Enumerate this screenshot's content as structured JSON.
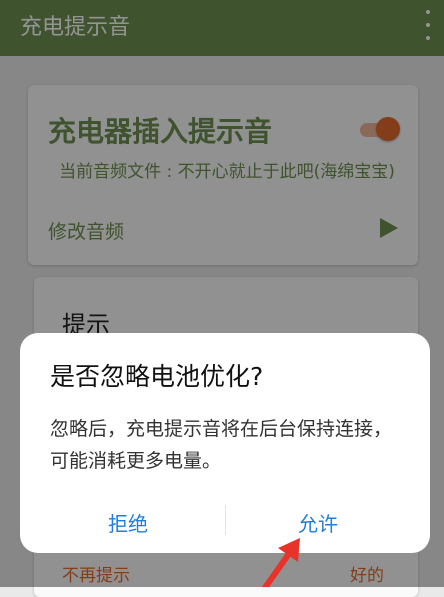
{
  "app": {
    "title": "充电提示音"
  },
  "charger_card": {
    "title": "充电器插入提示音",
    "toggle_on": true,
    "file_label": "当前音频文件 : 不开心就止于此吧(海绵宝宝)",
    "modify_label": "修改音频"
  },
  "tip_card": {
    "title": "提示",
    "no_remind": "不再提示",
    "ok": "好的"
  },
  "dialog": {
    "title": "是否忽略电池优化?",
    "message": "忽略后，充电提示音将在后台保持连接，可能消耗更多电量。",
    "reject": "拒绝",
    "allow": "允许"
  },
  "colors": {
    "accent_green": "#6e8f51",
    "accent_orange": "#e26a2c",
    "dialog_button_blue": "#1e7de0",
    "annotation_arrow_red": "#e8332a"
  }
}
